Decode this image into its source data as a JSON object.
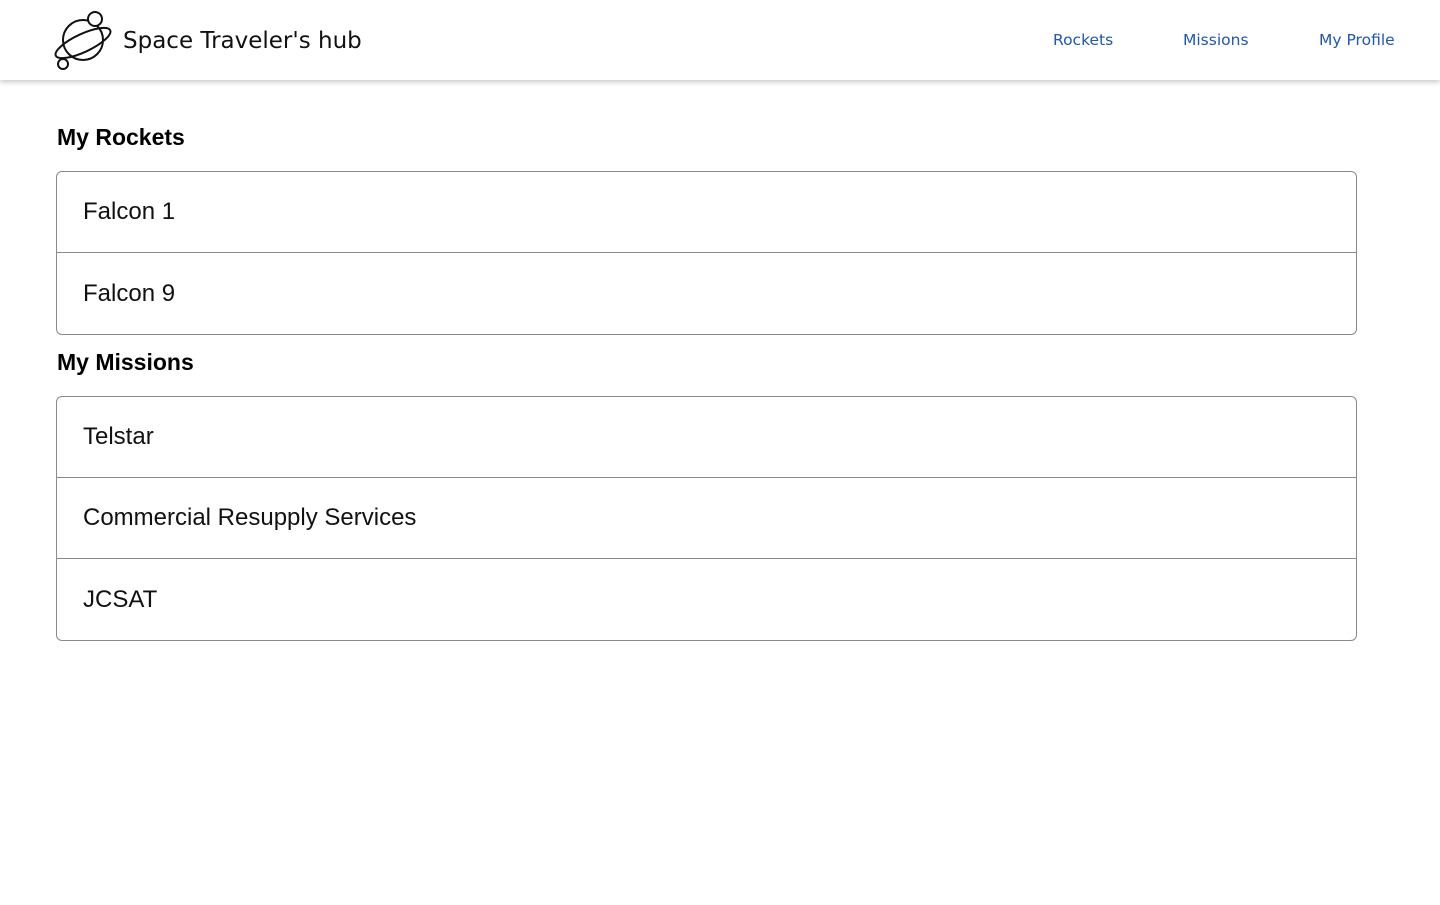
{
  "header": {
    "logo_icon": "planet-icon",
    "title": "Space Traveler's hub",
    "nav": [
      {
        "label": "Rockets"
      },
      {
        "label": "Missions"
      },
      {
        "label": "My Profile"
      }
    ],
    "link_color": "#1e57b4"
  },
  "profile": {
    "rockets": {
      "heading": "My Rockets",
      "items": [
        "Falcon 1",
        "Falcon 9"
      ]
    },
    "missions": {
      "heading": "My Missions",
      "items": [
        "Telstar",
        "Commercial Resupply Services",
        "JCSAT"
      ]
    }
  }
}
